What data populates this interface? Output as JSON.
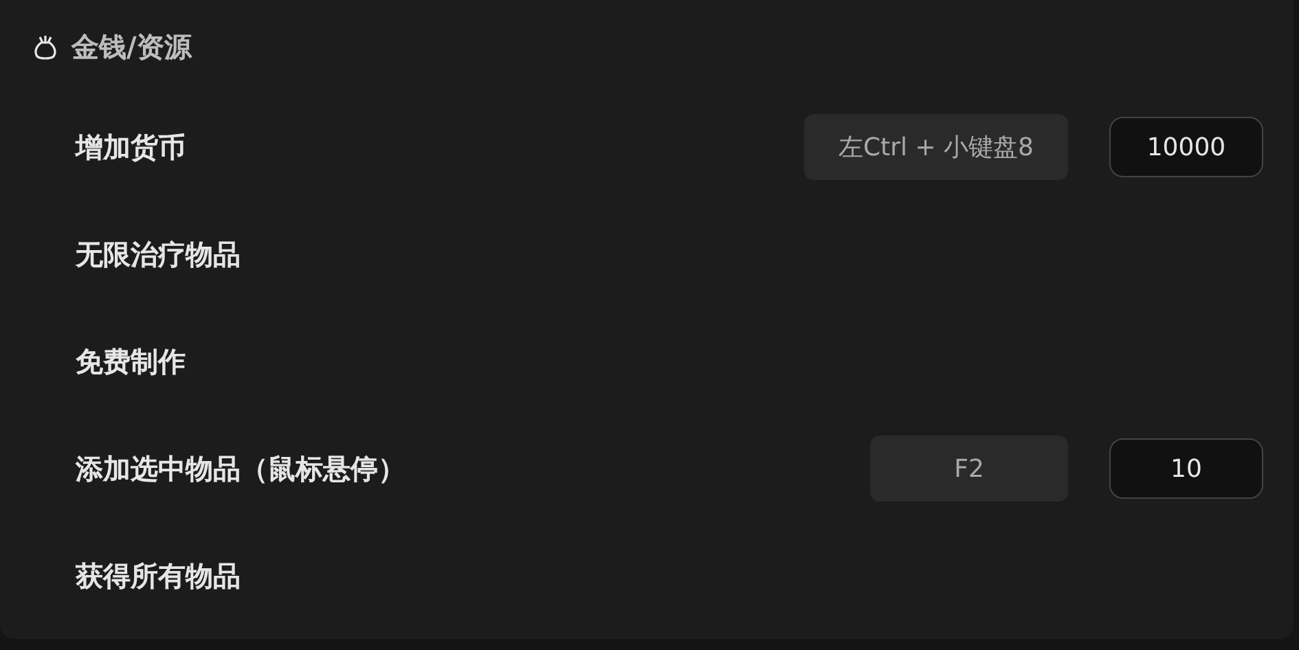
{
  "section": {
    "title": "金钱/资源"
  },
  "rows": [
    {
      "label": "增加货币",
      "hotkey": "左Ctrl + 小键盘8",
      "value": "10000"
    },
    {
      "label": "无限治疗物品"
    },
    {
      "label": "免费制作"
    },
    {
      "label": "添加选中物品（鼠标悬停）",
      "hotkey": "F2",
      "value": "10"
    },
    {
      "label": "获得所有物品"
    }
  ]
}
